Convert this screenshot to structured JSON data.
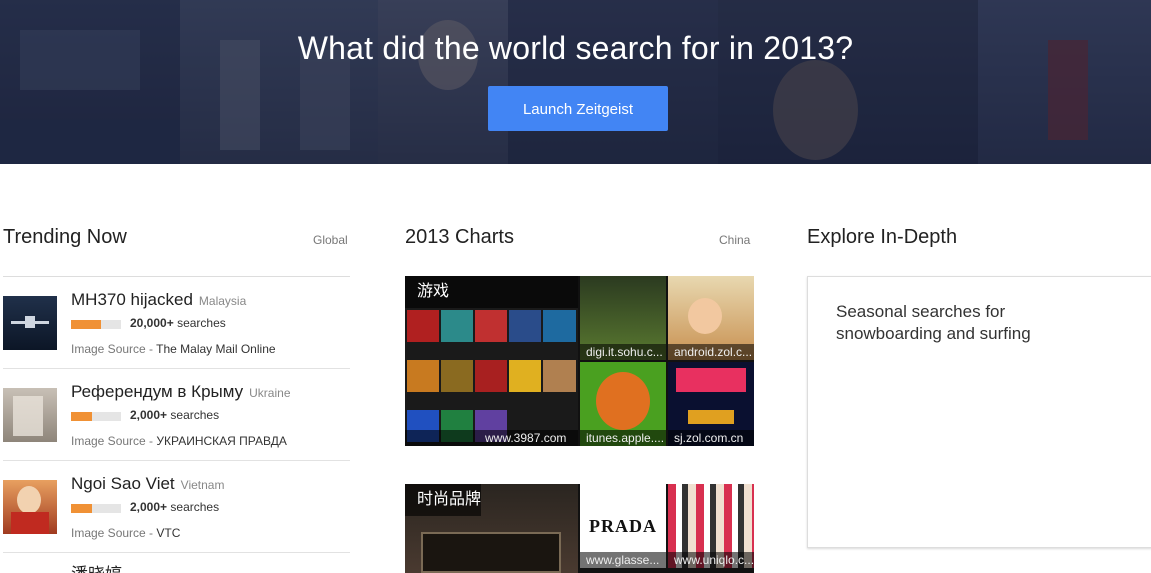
{
  "hero": {
    "title": "What did the world search for in 2013?",
    "button_label": "Launch Zeitgeist"
  },
  "trending": {
    "heading": "Trending Now",
    "region": "Global",
    "items": [
      {
        "title": "MH370 hijacked",
        "location": "Malaysia",
        "count": "20,000+",
        "count_suffix": "searches",
        "popularity": 0.6,
        "source_label": "Image Source - ",
        "source_name": "The Malay Mail Online"
      },
      {
        "title": "Референдум в Крыму",
        "location": "Ukraine",
        "count": "2,000+",
        "count_suffix": "searches",
        "popularity": 0.42,
        "source_label": "Image Source - ",
        "source_name": "УКРАИНСКАЯ ПРАВДА"
      },
      {
        "title": "Ngoi Sao Viet",
        "location": "Vietnam",
        "count": "2,000+",
        "count_suffix": "searches",
        "popularity": 0.42,
        "source_label": "Image Source - ",
        "source_name": "VTC"
      },
      {
        "title": "潘晓婷",
        "location": "",
        "count": "",
        "count_suffix": "",
        "popularity": 0,
        "source_label": "",
        "source_name": ""
      }
    ]
  },
  "charts": {
    "heading": "2013 Charts",
    "region": "China",
    "cards": [
      {
        "label": "游戏",
        "captions": [
          "digi.it.sohu.c...",
          "android.zol.c...",
          "www.3987.com",
          "itunes.apple....",
          "sj.zol.com.cn"
        ]
      },
      {
        "label": "时尚品牌",
        "captions": [
          "www.glasse...",
          "www.uniqlo.c..."
        ]
      }
    ]
  },
  "explore": {
    "heading": "Explore In-Depth",
    "card_text": "Seasonal searches for snowboarding and surfing"
  },
  "colors": {
    "accent_button": "#4285f4",
    "popularity_bar": "#f09135",
    "hero_bg": "#1c2540"
  }
}
